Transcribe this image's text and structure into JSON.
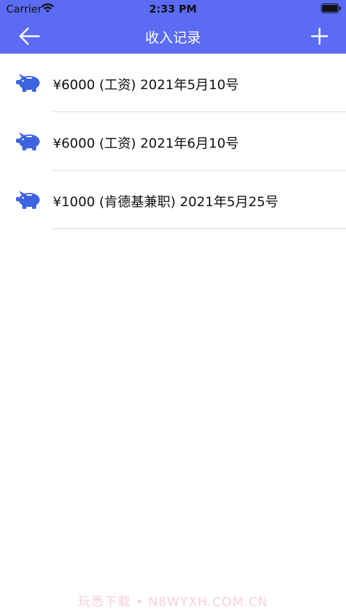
{
  "status_bar": {
    "carrier": "Carrier",
    "time": "2:33 PM"
  },
  "nav": {
    "title": "收入记录",
    "back_icon": "arrow-left-icon",
    "add_icon": "plus-icon"
  },
  "records": [
    {
      "text": "¥6000 (工资) 2021年5月10号",
      "icon": "piggy-bank-icon"
    },
    {
      "text": "¥6000 (工资) 2021年6月10号",
      "icon": "piggy-bank-icon"
    },
    {
      "text": "¥1000 (肯德基兼职) 2021年5月25号",
      "icon": "piggy-bank-icon"
    }
  ],
  "watermark": "玩悉下载 • N8WYXH.COM.CN",
  "colors": {
    "nav_background": "#5b6bf3",
    "icon_blue": "#3d63e0"
  }
}
